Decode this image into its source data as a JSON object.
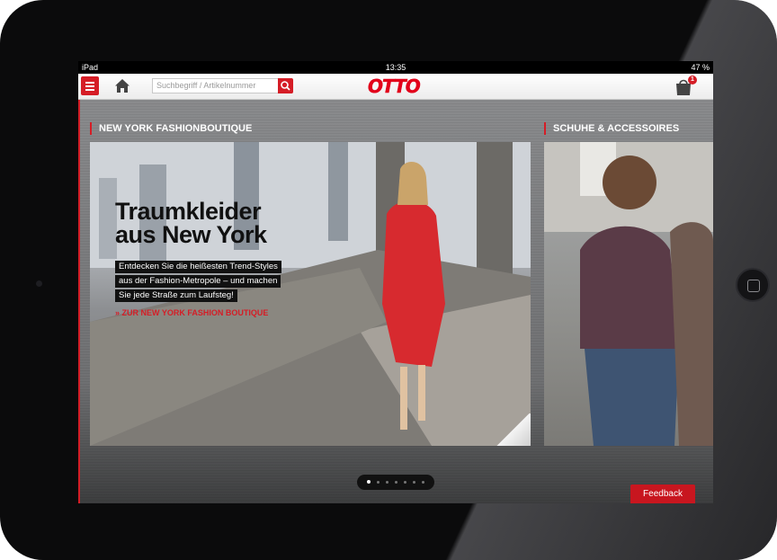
{
  "status_bar": {
    "carrier": "iPad",
    "time": "13:35",
    "battery": "47 %"
  },
  "header": {
    "menu_icon": "hamburger-icon",
    "home_icon": "home-icon",
    "search_placeholder": "Suchbegriff / Artikelnummer",
    "logo": "OTTO",
    "cart_count": "1"
  },
  "sections": [
    {
      "title": "NEW YORK FASHIONBOUTIQUE",
      "headline_line1": "Traumkleider",
      "headline_line2": "aus New York",
      "subtext": [
        "Entdecken Sie die heißesten Trend-Styles",
        "aus der Fashion-Metropole – und machen",
        "Sie jede Straße zum Laufsteg!"
      ],
      "link": "» ZUR NEW YORK FASHION BOUTIQUE"
    },
    {
      "title": "SCHUHE & ACCESSOIRES"
    }
  ],
  "pager": {
    "pages": 7,
    "current": 1
  },
  "feedback": "Feedback",
  "colors": {
    "brand_red": "#e2001a",
    "accent_red": "#d51d26"
  }
}
